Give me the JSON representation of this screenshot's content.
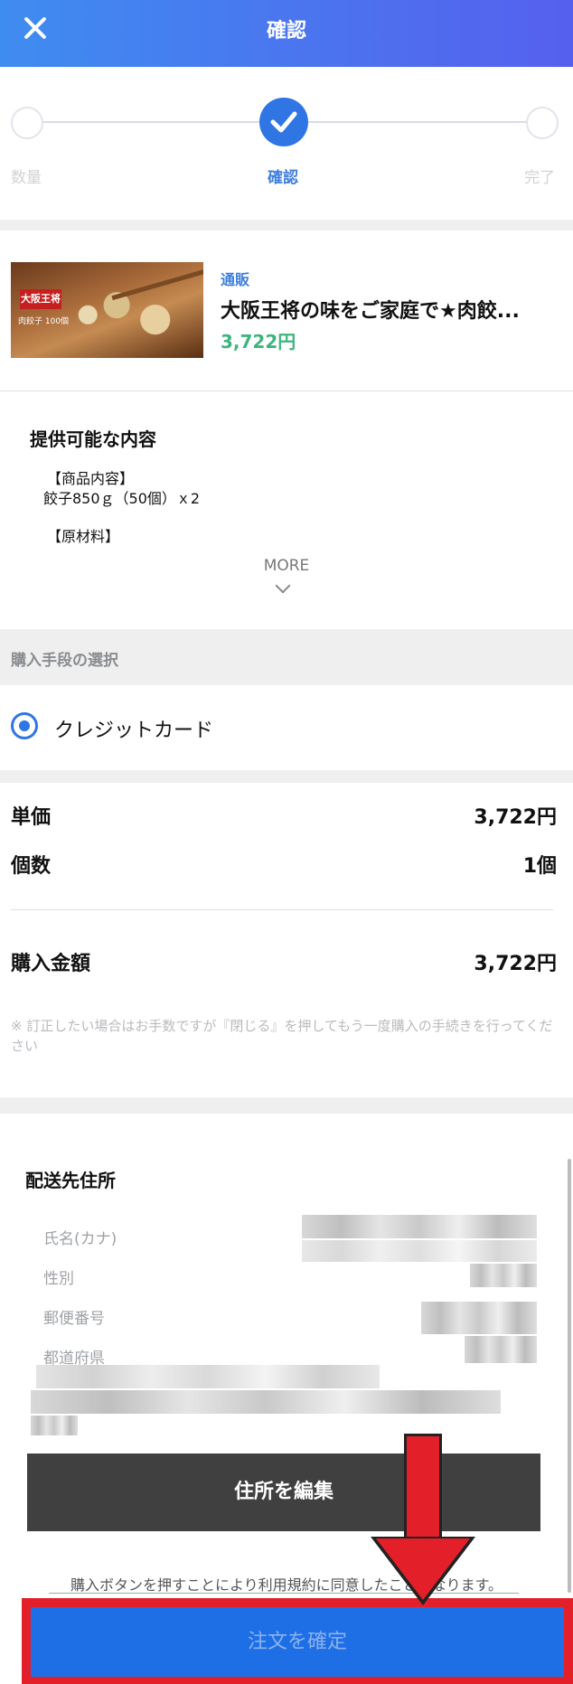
{
  "header": {
    "title": "確認",
    "close_icon": "close-icon"
  },
  "stepper": {
    "steps": [
      {
        "label": "数量"
      },
      {
        "label": "確認"
      },
      {
        "label": "完了"
      }
    ]
  },
  "product": {
    "tag": "通販",
    "title": "大阪王将の味をご家庭で★肉餃...",
    "price": "3,722円",
    "image_logo": "大阪王将",
    "image_sub": "肉餃子 100個"
  },
  "offer": {
    "title": "提供可能な内容",
    "lines": [
      "【商品内容】",
      "餃子850ｇ（50個）ｘ2",
      "【原材料】"
    ],
    "more": "MORE"
  },
  "payment": {
    "section_label": "購入手段の選択",
    "option_label": "クレジットカード"
  },
  "pricing": {
    "unit_price_label": "単価",
    "unit_price_value": "3,722円",
    "quantity_label": "個数",
    "quantity_value": "1個",
    "total_label": "購入金額",
    "total_value": "3,722円",
    "notice": "※ 訂正したい場合はお手数ですが『閉じる』を押してもう一度購入の手続きを行ってください"
  },
  "address": {
    "title": "配送先住所",
    "fields": [
      "氏名(カナ)",
      "性別",
      "郵便番号",
      "都道府県"
    ],
    "edit_button": "住所を編集"
  },
  "terms": "購入ボタンを押すことにより利用規約に同意したことになります。",
  "confirm_button": "注文を確定"
}
